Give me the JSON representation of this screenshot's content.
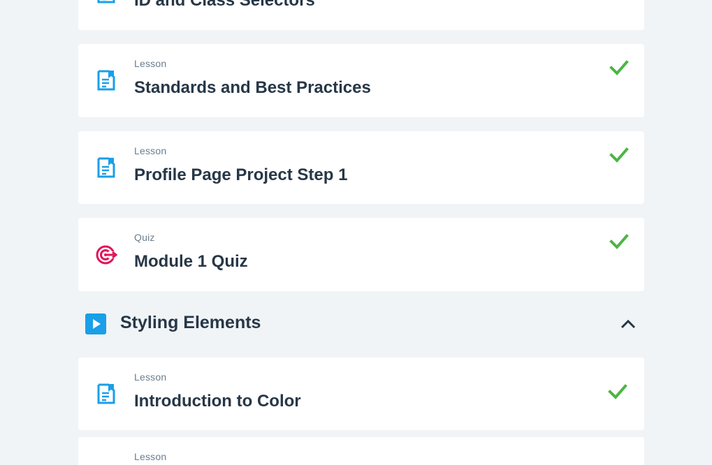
{
  "colors": {
    "background": "#f0f4f7",
    "card": "#ffffff",
    "title_text": "#273747",
    "type_text": "#6b7c8d",
    "lesson_icon": "#1a9fe8",
    "quiz_icon": "#e0145a",
    "check": "#4bb543"
  },
  "top_card": {
    "title": "ID and Class Selectors",
    "icon": "lesson-document-icon"
  },
  "items_before": [
    {
      "type": "Lesson",
      "title": "Standards and Best Practices",
      "icon": "lesson-document-icon",
      "completed": true
    },
    {
      "type": "Lesson",
      "title": "Profile Page Project Step 1",
      "icon": "lesson-document-icon",
      "completed": true
    },
    {
      "type": "Quiz",
      "title": "Module 1 Quiz",
      "icon": "quiz-target-icon",
      "completed": true
    }
  ],
  "section": {
    "title": "Styling Elements",
    "icon": "play-icon",
    "toggle_icon": "chevron-up-icon",
    "expanded": true
  },
  "items_after": [
    {
      "type": "Lesson",
      "title": "Introduction to Color",
      "icon": "lesson-document-icon",
      "completed": true
    },
    {
      "type": "Lesson",
      "title": "",
      "icon": "lesson-document-icon",
      "completed": false
    }
  ]
}
